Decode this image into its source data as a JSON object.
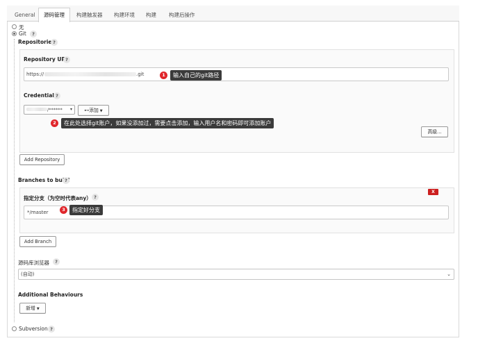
{
  "tabs": [
    "General",
    "源码管理",
    "构建触发器",
    "构建环境",
    "构建",
    "构建后操作"
  ],
  "scm": {
    "none_label": "无",
    "git_label": "Git",
    "subversion_label": "Subversion"
  },
  "help_glyph": "?",
  "repositories": {
    "title": "Repositories",
    "url_label": "Repository URL",
    "url_prefix": "https://",
    "url_suffix": ".git",
    "credentials_label": "Credentials",
    "credentials_value": "/******",
    "add_button": "添加",
    "advanced_button": "高级...",
    "add_repository_button": "Add Repository"
  },
  "branches": {
    "title": "Branches to build",
    "specifier_label": "指定分支（为空时代表any）",
    "specifier_value": "*/master",
    "delete_button": "X",
    "add_branch_button": "Add Branch"
  },
  "browser": {
    "label": "源码库浏览器",
    "value": "(自动)"
  },
  "behaviours": {
    "title": "Additional Behaviours",
    "add_button": "新增"
  },
  "annotations": [
    {
      "number": "1",
      "text": "输入自己的git路径"
    },
    {
      "number": "2",
      "text": "在此处选择git账户，如果没添加过，需要点击添加，输入用户名和密码即可添加账户"
    },
    {
      "number": "3",
      "text": "指定好分支"
    }
  ],
  "colors": {
    "annotation_badge": "#e0262b",
    "annotation_note": "#3b3b3b",
    "delete_button": "#cc1f1f"
  }
}
